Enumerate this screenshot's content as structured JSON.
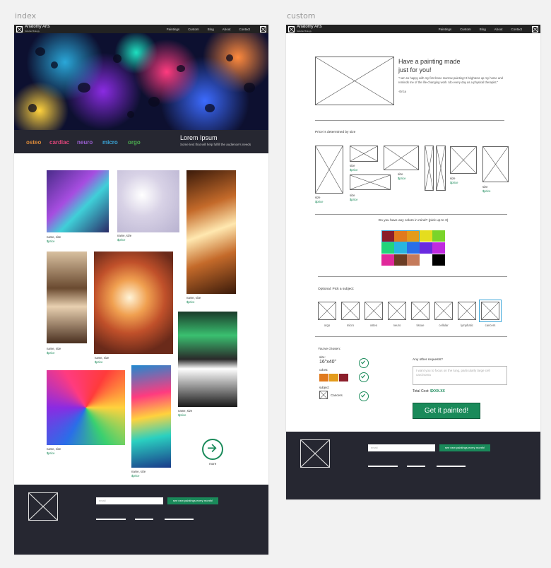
{
  "frames": {
    "index_label": "index",
    "custom_label": "custom"
  },
  "nav": {
    "brand": "Anatomy Arts",
    "brand_sub": "Sidebar Biology",
    "links": [
      "Paintings",
      "Custom",
      "Blog",
      "About",
      "Contact"
    ]
  },
  "index": {
    "categories": [
      {
        "label": "osteo",
        "color": "#d9893a"
      },
      {
        "label": "cardiac",
        "color": "#e0457a"
      },
      {
        "label": "neuro",
        "color": "#9a5fd0"
      },
      {
        "label": "micro",
        "color": "#3aa6d9"
      },
      {
        "label": "orgo",
        "color": "#4caf50"
      }
    ],
    "hero_title": "Lorem Ipsum",
    "hero_sub": "Some text that will help fulfill the audience's needs",
    "paintings": [
      {
        "name": "name, size",
        "price": "$price"
      },
      {
        "name": "name, size",
        "price": "$price"
      },
      {
        "name": "name, size",
        "price": "$price"
      },
      {
        "name": "name, size",
        "price": "$price"
      },
      {
        "name": "name, size",
        "price": "$price"
      },
      {
        "name": "name, size",
        "price": "$price"
      },
      {
        "name": "name, size",
        "price": "$price"
      },
      {
        "name": "name, size",
        "price": "$price"
      }
    ],
    "more_label": "more"
  },
  "footer": {
    "email_placeholder": "email",
    "signup_label": "see new paintings every month!"
  },
  "custom": {
    "heading_line1": "Have a painting made",
    "heading_line2": "just for you!",
    "testimonial": "\"I am so happy with my first bone marrow painting! It brightens up my home and reminds me of the life-changing work I do every day as a physical therapist.\"",
    "testimonial_author": "-Erica",
    "price_label": "Price is determined by size",
    "size_caption": "size",
    "size_price": "$price",
    "colors_question": "Do you have any colors in mind? (pick up to 3)",
    "color_swatches": [
      "#8b1e2b",
      "#e07a1e",
      "#e39b1b",
      "#e5dd1e",
      "#7ad42a",
      "#22d47a",
      "#28b6e0",
      "#2a6ee8",
      "#6a2ae0",
      "#c02ae0",
      "#e0289a",
      "#6b3d24",
      "#c47a5a",
      "#ffffff",
      "#000000"
    ],
    "subject_label": "Optional: Pick a subject:",
    "subjects": [
      "orgo",
      "micro",
      "osteo",
      "neuro",
      "tissue",
      "cellular",
      "lymphatic",
      "cancers"
    ],
    "chosen_label": "You've chosen:",
    "size_label": "size:",
    "size_value": "16\"x40\"",
    "colors_label": "colors:",
    "chosen_colors": [
      "#e07a1e",
      "#e39b1b",
      "#8b1e2b"
    ],
    "subject_chosen_label": "subject:",
    "subject_chosen": "Cancers",
    "requests_label": "Any other requests?",
    "requests_placeholder": "I want you to focus on the lung, particularly large cell carcinoma",
    "total_label": "Total Cost:",
    "total_value": "$XXX.XX",
    "cta": "Get it painted!"
  }
}
